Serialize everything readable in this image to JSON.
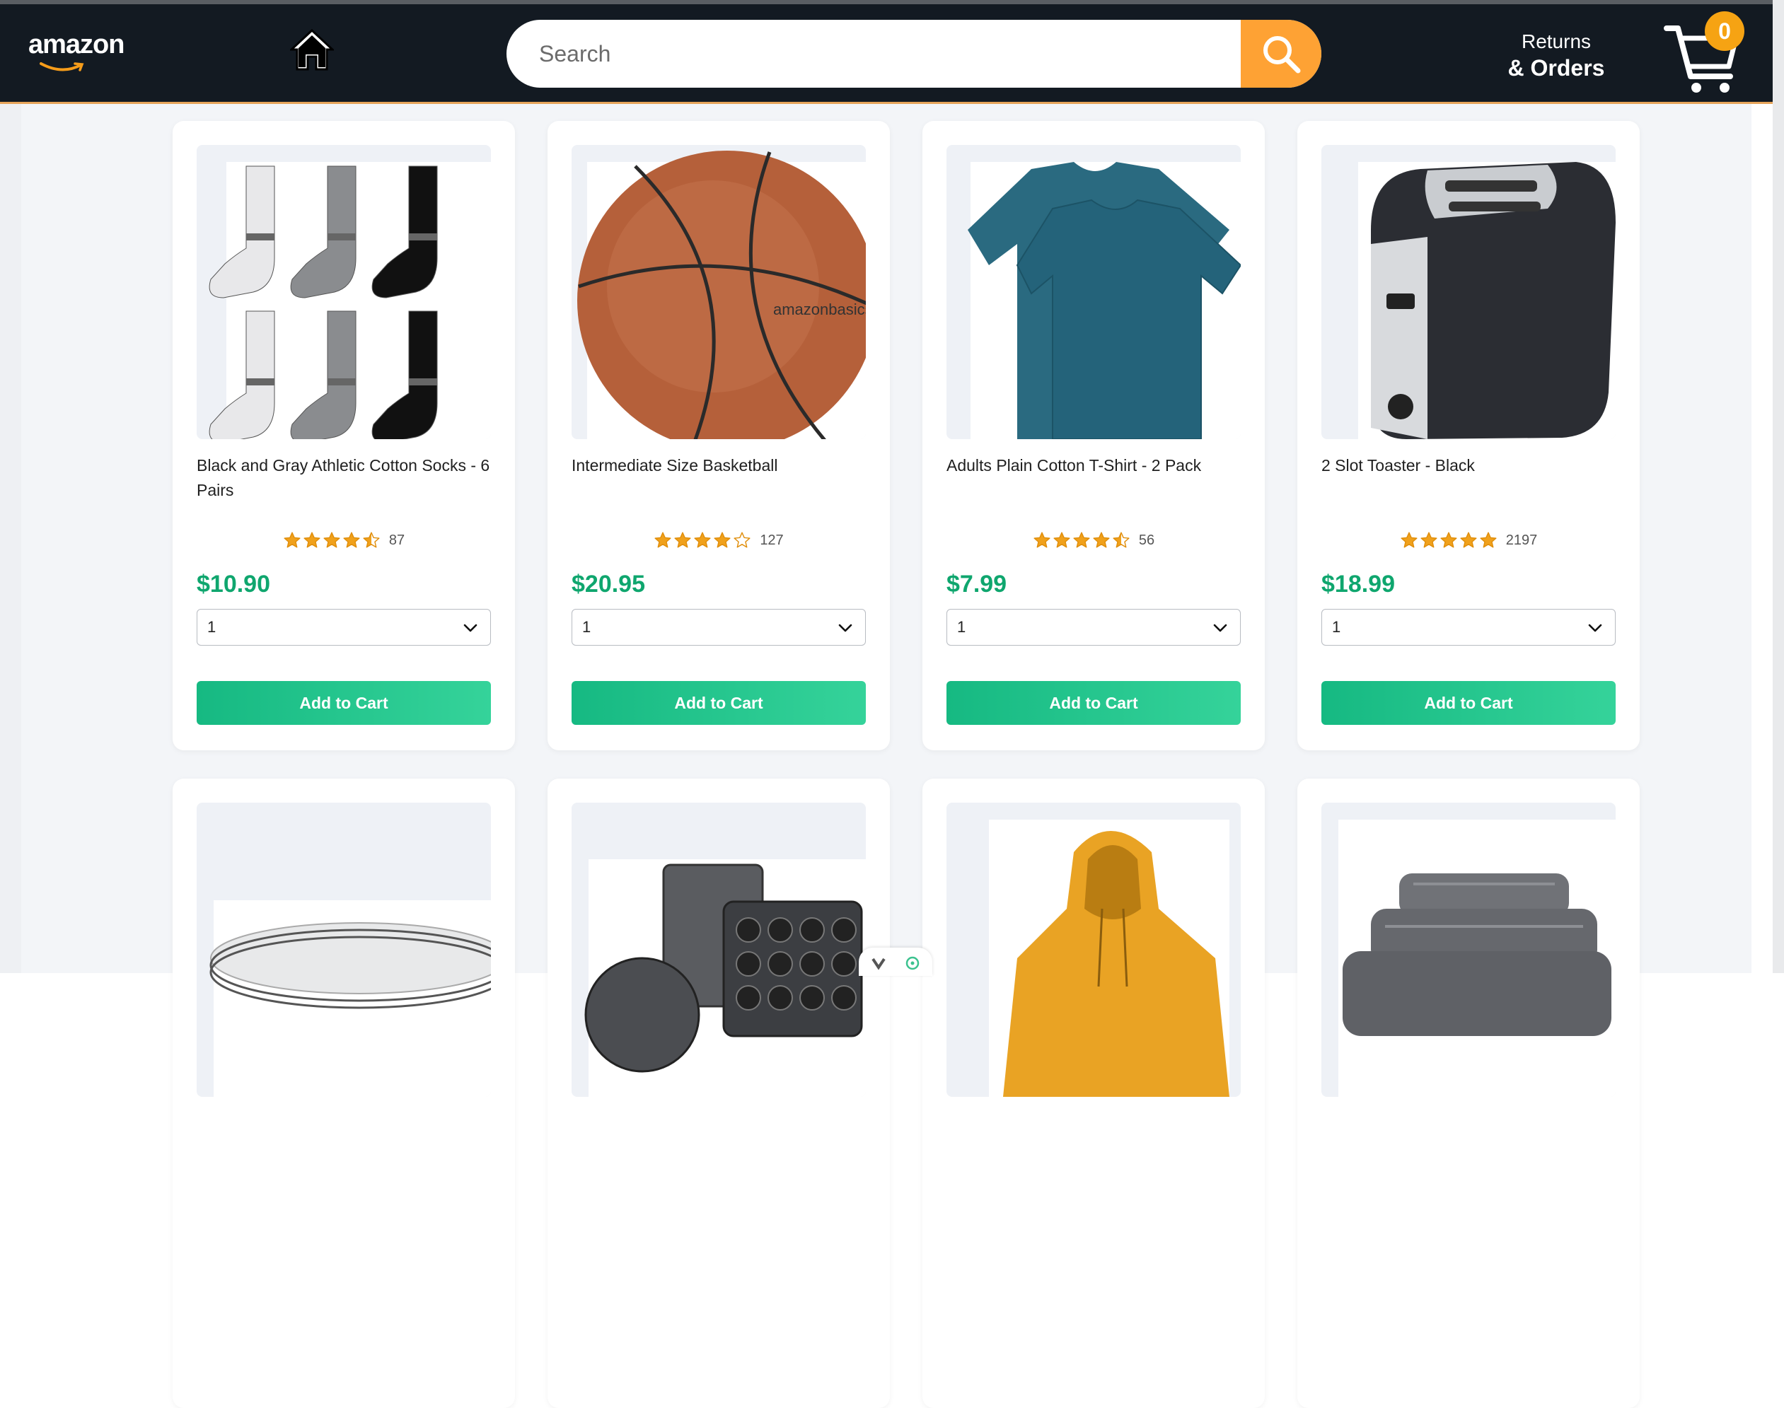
{
  "header": {
    "logo_text": "amazon",
    "search": {
      "placeholder": "Search",
      "value": ""
    },
    "returns": {
      "line1": "Returns",
      "line2": "& Orders"
    },
    "cart_count": "0"
  },
  "colors": {
    "header_bg": "#131a22",
    "search_button": "#fea234",
    "price_green": "#0fa66e",
    "button_green": "#16b982",
    "star_orange": "#f0a11c",
    "cart_badge": "#f6a313"
  },
  "products": [
    {
      "name": "Black and Gray Athletic Cotton Socks - 6 Pairs",
      "rating": 4.5,
      "rating_count": "87",
      "price": "$10.90",
      "quantity": "1",
      "button_label": "Add to Cart",
      "image": "socks"
    },
    {
      "name": "Intermediate Size Basketball",
      "rating": 4.0,
      "rating_count": "127",
      "price": "$20.95",
      "quantity": "1",
      "button_label": "Add to Cart",
      "image": "basketball"
    },
    {
      "name": "Adults Plain Cotton T-Shirt - 2 Pack",
      "rating": 4.5,
      "rating_count": "56",
      "price": "$7.99",
      "quantity": "1",
      "button_label": "Add to Cart",
      "image": "tshirt"
    },
    {
      "name": "2 Slot Toaster - Black",
      "rating": 5.0,
      "rating_count": "2197",
      "price": "$18.99",
      "quantity": "1",
      "button_label": "Add to Cart",
      "image": "toaster"
    },
    {
      "image": "plates"
    },
    {
      "image": "bakeware"
    },
    {
      "image": "hoodie"
    },
    {
      "image": "towels"
    }
  ]
}
